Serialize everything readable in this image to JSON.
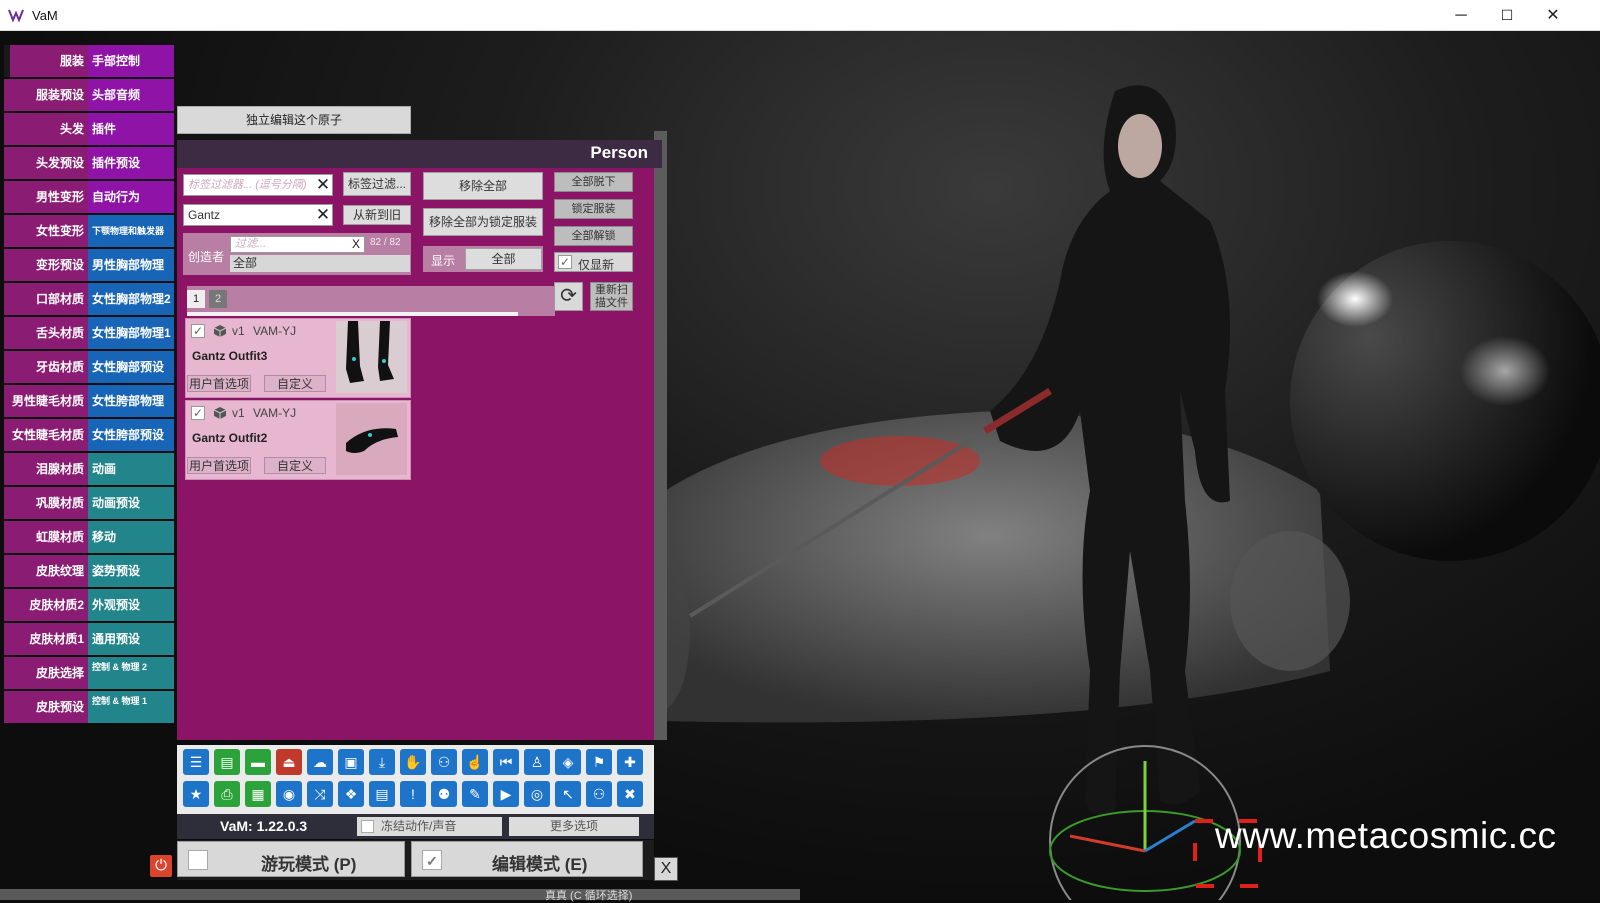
{
  "window": {
    "title": "VaM",
    "minimize_icon": "─",
    "maximize_icon": "☐",
    "close_icon": "✕"
  },
  "left_menu": [
    {
      "left": "服装",
      "right": "手部控制",
      "right_color": "purple"
    },
    {
      "left": "服装预设",
      "right": "头部音频",
      "right_color": "purple"
    },
    {
      "left": "头发",
      "right": "插件",
      "right_color": "purple"
    },
    {
      "left": "头发预设",
      "right": "插件预设",
      "right_color": "purple"
    },
    {
      "left": "男性变形",
      "right": "自动行为",
      "right_color": "purple"
    },
    {
      "left": "女性变形",
      "right": "下颚物理和触发器",
      "right_color": "blue"
    },
    {
      "left": "变形预设",
      "right": "男性胸部物理",
      "right_color": "blue"
    },
    {
      "left": "口部材质",
      "right": "女性胸部物理2",
      "right_color": "blue"
    },
    {
      "left": "舌头材质",
      "right": "女性胸部物理1",
      "right_color": "blue"
    },
    {
      "left": "牙齿材质",
      "right": "女性胸部预设",
      "right_color": "blue"
    },
    {
      "left": "男性睫毛材质",
      "right": "女性胯部物理",
      "right_color": "blue"
    },
    {
      "left": "女性睫毛材质",
      "right": "女性胯部预设",
      "right_color": "blue"
    },
    {
      "left": "泪腺材质",
      "right": "动画",
      "right_color": "teal"
    },
    {
      "left": "巩膜材质",
      "right": "动画预设",
      "right_color": "teal"
    },
    {
      "left": "虹膜材质",
      "right": "移动",
      "right_color": "teal"
    },
    {
      "left": "皮肤纹理",
      "right": "姿势预设",
      "right_color": "teal"
    },
    {
      "left": "皮肤材质2",
      "right": "外观预设",
      "right_color": "teal"
    },
    {
      "left": "皮肤材质1",
      "right": "通用预设",
      "right_color": "teal"
    },
    {
      "left": "皮肤选择",
      "right": "控制 & 物理 2",
      "right_color": "teal"
    },
    {
      "left": "皮肤预设",
      "right": "控制 & 物理 1",
      "right_color": "teal"
    }
  ],
  "panel": {
    "isolate_button": "独立编辑这个原子",
    "title": "Person",
    "tag_filter_placeholder": "标签过滤器... (逗号分隔)",
    "tag_filter_button": "标签过滤...",
    "search_value": "Gantz",
    "sort_button": "从新到旧",
    "remove_all": "移除全部",
    "remove_all_lock": "移除全部为锁定服装",
    "undress_all": "全部脱下",
    "lock_clothing": "锁定服装",
    "unlock_all": "全部解锁",
    "new_only": "仅显新",
    "creator_label": "创造者",
    "creator_filter_placeholder": "过滤...",
    "creator_filter_clear": "X",
    "creator_count": "82 / 82",
    "creator_selected": "全部",
    "display_label": "显示",
    "display_value": "全部",
    "rescan_button": "重新扫描文件",
    "pages": [
      "1",
      "2"
    ],
    "items": [
      {
        "version": "v1",
        "creator": "VAM-YJ",
        "name": "Gantz Outfit3",
        "user_pref": "用户首选项",
        "custom": "自定义"
      },
      {
        "version": "v1",
        "creator": "VAM-YJ",
        "name": "Gantz Outfit2",
        "user_pref": "用户首选项",
        "custom": "自定义"
      }
    ]
  },
  "toolbar": {
    "row1": [
      "menu-icon",
      "open-scene-icon",
      "folder-icon",
      "unload-icon",
      "cloud-icon",
      "box-icon",
      "save-icon",
      "hand-icon",
      "add-person-icon",
      "touch-icon",
      "rewind-icon",
      "person-icon",
      "unity-icon",
      "flag-icon",
      "plus-icon"
    ],
    "row2": [
      "star-icon",
      "print-icon",
      "screenshot-icon",
      "camera-icon",
      "share-icon",
      "package-icon",
      "document-icon",
      "alert-icon",
      "person-remove-icon",
      "wrench-hand-icon",
      "play-icon",
      "target-icon",
      "cursor-icon",
      "people-icon",
      "tools-icon"
    ],
    "version": "VaM: 1.22.0.3",
    "freeze_label": "冻结动作/声音",
    "more_options": "更多选项"
  },
  "modes": {
    "play": "游玩模式 (P)",
    "edit": "编辑模式 (E)",
    "close": "X"
  },
  "bottom_strip": "真真 (C 循环选择)",
  "watermark": "www.metacosmic.cc",
  "colors": {
    "panel_bg": "#8b1466",
    "menu_left": "#8b1c73",
    "menu_purple": "#8e13a6",
    "menu_blue": "#1865b8",
    "menu_teal": "#23858c",
    "toolbar_icon": "#1e74c8"
  }
}
